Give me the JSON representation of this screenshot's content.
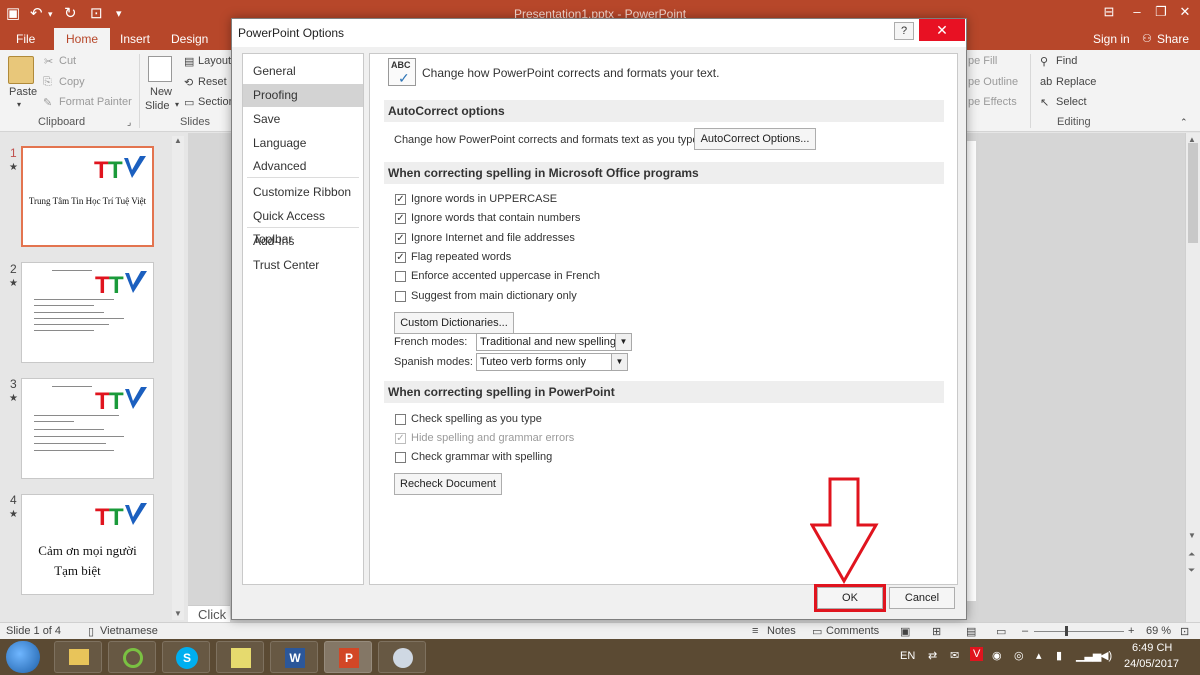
{
  "window": {
    "title": "Presentation1.pptx - PowerPoint"
  },
  "quick_access": [
    "save-icon",
    "undo-icon",
    "redo-icon",
    "present-icon"
  ],
  "ribbon_tabs": [
    "File",
    "Home",
    "Insert",
    "Design"
  ],
  "account": {
    "sign_in": "Sign in",
    "share": "Share"
  },
  "ribbon": {
    "clipboard": {
      "paste": "Paste",
      "cut": "Cut",
      "copy": "Copy",
      "format_painter": "Format Painter",
      "group": "Clipboard"
    },
    "slides": {
      "new_slide_line1": "New",
      "new_slide_line2": "Slide",
      "layout": "Layout",
      "reset": "Reset",
      "section": "Section",
      "group": "Slides"
    },
    "drawing": {
      "shape_fill": "pe Fill",
      "shape_outline": "pe Outline",
      "shape_effects": "pe Effects"
    },
    "editing": {
      "find": "Find",
      "replace": "Replace",
      "select": "Select",
      "group": "Editing"
    }
  },
  "slides": [
    {
      "num": "1",
      "title": "Trung Tâm Tin Học Trí Tuệ Việt"
    },
    {
      "num": "2",
      "title": ""
    },
    {
      "num": "3",
      "title": ""
    },
    {
      "num": "4",
      "line1": "Cảm ơn mọi người",
      "line2": "Tạm biệt"
    }
  ],
  "editor": {
    "click_text": "Click"
  },
  "statusbar": {
    "slide_info": "Slide 1 of 4",
    "language": "Vietnamese",
    "notes": "Notes",
    "comments": "Comments",
    "zoom": "69 %"
  },
  "taskbar": {
    "lang": "EN",
    "time": "6:49 CH",
    "date": "24/05/2017"
  },
  "dialog": {
    "title": "PowerPoint Options",
    "help": "?",
    "close": "✕",
    "nav": [
      "General",
      "Proofing",
      "Save",
      "Language",
      "Advanced",
      "Customize Ribbon",
      "Quick Access Toolbar",
      "Add-Ins",
      "Trust Center"
    ],
    "nav_active": "Proofing",
    "header_text": "Change how PowerPoint corrects and formats your text.",
    "autocorrect": {
      "section": "AutoCorrect options",
      "label": "Change how PowerPoint corrects and formats text as you type:",
      "button": "AutoCorrect Options..."
    },
    "office_spelling": {
      "section": "When correcting spelling in Microsoft Office programs",
      "options": [
        {
          "label": "Ignore words in UPPERCASE",
          "checked": true
        },
        {
          "label": "Ignore words that contain numbers",
          "checked": true
        },
        {
          "label": "Ignore Internet and file addresses",
          "checked": true
        },
        {
          "label": "Flag repeated words",
          "checked": true
        },
        {
          "label": "Enforce accented uppercase in French",
          "checked": false
        },
        {
          "label": "Suggest from main dictionary only",
          "checked": false
        }
      ],
      "custom_dict_button": "Custom Dictionaries...",
      "french_label": "French modes:",
      "french_value": "Traditional and new spellings",
      "spanish_label": "Spanish modes:",
      "spanish_value": "Tuteo verb forms only"
    },
    "ppt_spelling": {
      "section": "When correcting spelling in PowerPoint",
      "options": [
        {
          "label": "Check spelling as you type",
          "checked": false,
          "disabled": false
        },
        {
          "label": "Hide spelling and grammar errors",
          "checked": true,
          "disabled": true
        },
        {
          "label": "Check grammar with spelling",
          "checked": false,
          "disabled": false
        }
      ],
      "recheck_button": "Recheck Document"
    },
    "ok": "OK",
    "cancel": "Cancel"
  },
  "colors": {
    "accent": "#b7472a",
    "highlight": "#e0141e"
  }
}
